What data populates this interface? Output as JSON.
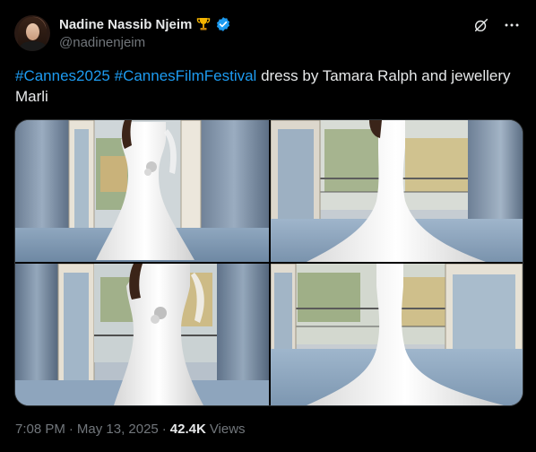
{
  "author": {
    "display_name": "Nadine Nassib Njeim",
    "handle": "@nadinenjeim",
    "badges": [
      "trophy-icon",
      "verified-icon"
    ]
  },
  "actions": {
    "grok_icon": "grok-icon",
    "more_icon": "more-icon"
  },
  "tweet": {
    "hashtag1": "#Cannes2025",
    "hashtag2": "#CannesFilmFestival",
    "text_rest": " dress by Tamara Ralph and jewellery Marli"
  },
  "media": {
    "count": 4
  },
  "meta": {
    "time": "7:08 PM",
    "sep1": "·",
    "date": "May 13, 2025",
    "sep2": "·",
    "views": "42.4K",
    "views_label": "Views"
  },
  "colors": {
    "background": "#000000",
    "text": "#e7e9ea",
    "secondary": "#71767b",
    "link": "#1d9bf0",
    "verified": "#1d9bf0"
  }
}
